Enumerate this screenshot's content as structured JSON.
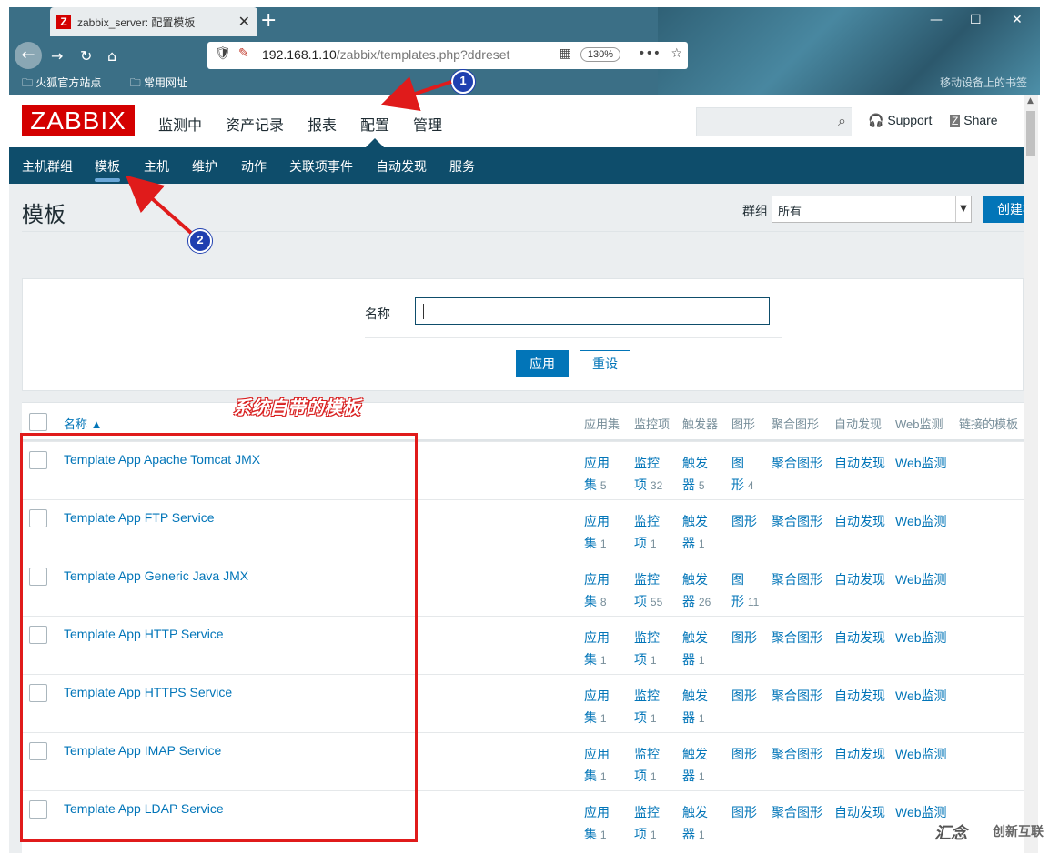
{
  "browser": {
    "tab_title": "zabbix_server: 配置模板",
    "tab_favicon_letter": "Z",
    "tab_close": "✕",
    "new_tab": "+",
    "url_main": "192.168.1.10",
    "url_rest": "/zabbix/templates.php?ddreset",
    "zoom": "130%",
    "bookmarks": [
      "火狐官方站点",
      "常用网址"
    ],
    "bookmarks_right": "移动设备上的书签",
    "icons": [
      "back-icon",
      "forward-icon",
      "reload-icon",
      "home-icon",
      "shield-icon",
      "qr-icon",
      "more-icon",
      "star-icon"
    ]
  },
  "header": {
    "logo": "ZABBIX",
    "nav": [
      "监测中",
      "资产记录",
      "报表",
      "配置",
      "管理"
    ],
    "active_nav": "配置",
    "support": "Support",
    "share": "Share"
  },
  "subnav": {
    "items": [
      "主机群组",
      "模板",
      "主机",
      "维护",
      "动作",
      "关联项事件",
      "自动发现",
      "服务"
    ],
    "active": "模板"
  },
  "page": {
    "title": "模板",
    "group_label": "群组",
    "group_value": "所有",
    "create_button": "创建模板"
  },
  "filter": {
    "name_label": "名称",
    "name_value": "",
    "apply": "应用",
    "reset": "重设"
  },
  "table": {
    "headers": {
      "name": "名称 ▲",
      "applications": "应用集",
      "items": "监控项",
      "triggers": "触发器",
      "graphs": "图形",
      "screens": "聚合图形",
      "discovery": "自动发现",
      "web": "Web监测",
      "linked": "链接的模板"
    },
    "rows": [
      {
        "name": "Template App Apache Tomcat JMX",
        "app": [
          "应用",
          "集",
          "5"
        ],
        "items": [
          "监控",
          "项",
          "32"
        ],
        "triggers": [
          "触发",
          "器",
          "5"
        ],
        "graphs": [
          "图",
          "形",
          "4"
        ]
      },
      {
        "name": "Template App FTP Service",
        "app": [
          "应用",
          "集",
          "1"
        ],
        "items": [
          "监控",
          "项",
          "1"
        ],
        "triggers": [
          "触发",
          "器",
          "1"
        ],
        "graphs": [
          "图形",
          "",
          ""
        ]
      },
      {
        "name": "Template App Generic Java JMX",
        "app": [
          "应用",
          "集",
          "8"
        ],
        "items": [
          "监控",
          "项",
          "55"
        ],
        "triggers": [
          "触发",
          "器",
          "26"
        ],
        "graphs": [
          "图",
          "形",
          "11"
        ]
      },
      {
        "name": "Template App HTTP Service",
        "app": [
          "应用",
          "集",
          "1"
        ],
        "items": [
          "监控",
          "项",
          "1"
        ],
        "triggers": [
          "触发",
          "器",
          "1"
        ],
        "graphs": [
          "图形",
          "",
          ""
        ]
      },
      {
        "name": "Template App HTTPS Service",
        "app": [
          "应用",
          "集",
          "1"
        ],
        "items": [
          "监控",
          "项",
          "1"
        ],
        "triggers": [
          "触发",
          "器",
          "1"
        ],
        "graphs": [
          "图形",
          "",
          ""
        ]
      },
      {
        "name": "Template App IMAP Service",
        "app": [
          "应用",
          "集",
          "1"
        ],
        "items": [
          "监控",
          "项",
          "1"
        ],
        "triggers": [
          "触发",
          "器",
          "1"
        ],
        "graphs": [
          "图形",
          "",
          ""
        ]
      },
      {
        "name": "Template App LDAP Service",
        "app": [
          "应用",
          "集",
          "1"
        ],
        "items": [
          "监控",
          "项",
          "1"
        ],
        "triggers": [
          "触发",
          "器",
          "1"
        ],
        "graphs": [
          "图形",
          "",
          ""
        ]
      }
    ],
    "row_links": {
      "screens": "聚合图形",
      "discovery": "自动发现",
      "web": "Web监测"
    }
  },
  "annotation": {
    "note": "系统自带的模板",
    "badge1": "1",
    "badge2": "2",
    "accent": "#e01b1b"
  },
  "watermark": {
    "left": "汇念",
    "right": "创新互联"
  }
}
